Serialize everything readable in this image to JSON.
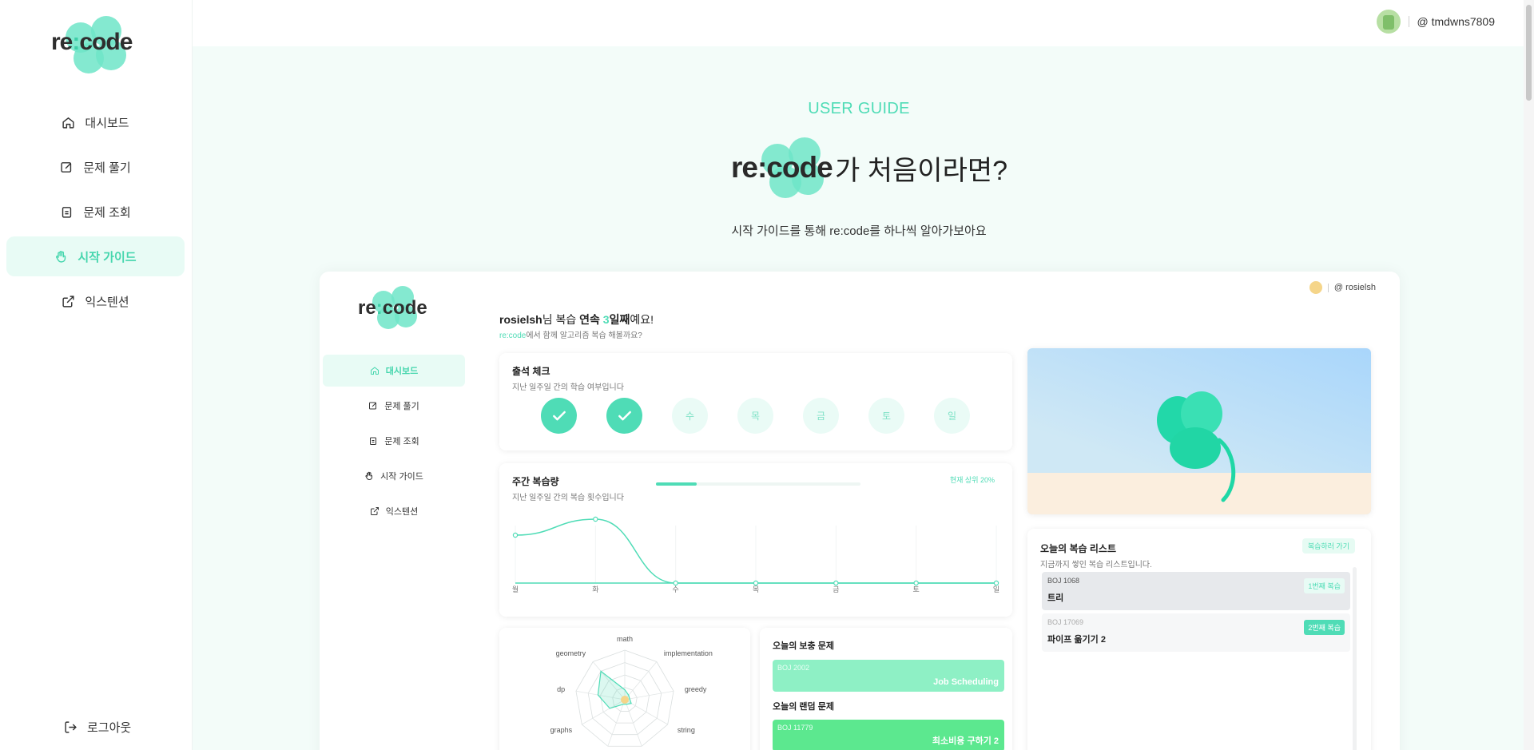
{
  "brand": {
    "logo_text": "re:code"
  },
  "sidebar": {
    "items": [
      {
        "label": "대시보드",
        "icon": "home-icon"
      },
      {
        "label": "문제 풀기",
        "icon": "edit-icon"
      },
      {
        "label": "문제 조회",
        "icon": "clipboard-icon"
      },
      {
        "label": "시작 가이드",
        "icon": "hand-icon",
        "active": true
      },
      {
        "label": "익스텐션",
        "icon": "external-link-icon"
      }
    ],
    "logout_label": "로그아웃"
  },
  "header": {
    "username": "@ tmdwns7809"
  },
  "hero": {
    "eyebrow": "USER GUIDE",
    "title_brand": "re:code",
    "title_rest": "가 처음이라면?",
    "subtitle": "시작 가이드를 통해 re:code를 하나씩 알아가보아요"
  },
  "preview": {
    "sidebar": {
      "items": [
        {
          "label": "대시보드",
          "active": true
        },
        {
          "label": "문제 풀기"
        },
        {
          "label": "문제 조회"
        },
        {
          "label": "시작 가이드"
        },
        {
          "label": "익스텐션"
        }
      ]
    },
    "username": "@ rosielsh",
    "greeting": {
      "name": "rosielsh",
      "pre": "님 복습 ",
      "bold": "연속 ",
      "count": "3",
      "post": "일째",
      "end": "예요!"
    },
    "greeting2": {
      "brand": "re:code",
      "text": "에서 함께 알고리즘 복습 해볼까요?"
    },
    "attendance": {
      "title": "출석 체크",
      "desc": "지난 일주일 간의 학습 여부입니다",
      "days": [
        {
          "label": "",
          "done": true
        },
        {
          "label": "",
          "done": true
        },
        {
          "label": "수",
          "done": false
        },
        {
          "label": "목",
          "done": false
        },
        {
          "label": "금",
          "done": false
        },
        {
          "label": "토",
          "done": false
        },
        {
          "label": "일",
          "done": false
        }
      ]
    },
    "weekly": {
      "title": "주간 복습량",
      "desc": "지난 일주일 간의 복습 횟수입니다",
      "rank": "현재 상위 20%",
      "progress": 0.2,
      "days": [
        "월",
        "화",
        "수",
        "목",
        "금",
        "토",
        "일"
      ],
      "values": [
        3,
        4,
        0,
        0,
        0,
        0,
        0
      ]
    },
    "radar": {
      "axes": [
        "math",
        "implementation",
        "greedy",
        "string",
        "",
        "",
        "graphs",
        "dp",
        "geometry"
      ],
      "values": [
        0.2,
        0.12,
        0.1,
        0.15,
        0.1,
        0.1,
        0.35,
        0.55,
        0.75
      ]
    },
    "problems": {
      "supplement_title": "오늘의 보충 문제",
      "supplement": {
        "id": "BOJ 2002",
        "name": "Job Scheduling"
      },
      "random_title": "오늘의 랜덤 문제",
      "random": {
        "id": "BOJ 11779",
        "name": "최소비용 구하기 2"
      }
    },
    "review": {
      "title": "오늘의 복습 리스트",
      "desc": "지금까지 쌓인 복습 리스트입니다.",
      "go_label": "복습하러 가기",
      "items": [
        {
          "id": "BOJ 1068",
          "name": "트리",
          "tag": "1번째 복습"
        },
        {
          "id": "BOJ 17069",
          "name": "파이프 옮기기 2",
          "tag": "2번째 복습"
        }
      ]
    }
  },
  "colors": {
    "mint": "#4fdcb6",
    "green": "#5ce88f",
    "sidebar_active_bg": "#e8fbf5"
  }
}
